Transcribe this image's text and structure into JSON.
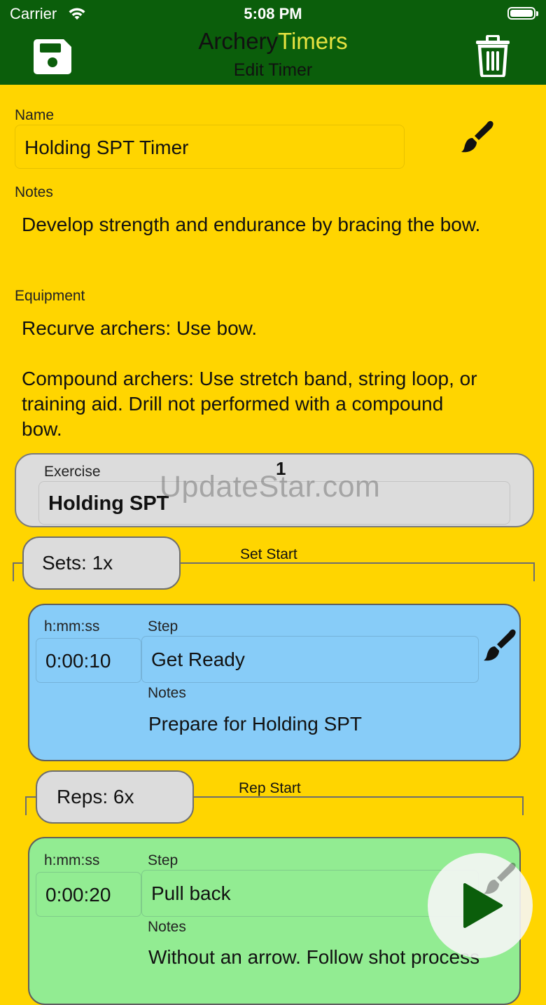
{
  "status": {
    "carrier": "Carrier",
    "time": "5:08 PM"
  },
  "nav": {
    "title_part1": "Archery",
    "title_part2": "Timers",
    "subtitle": "Edit Timer",
    "colors": {
      "background": "#0B5E0B",
      "accent": "#E7E340"
    },
    "left_icon": "save-icon",
    "right_icon": "trash-icon"
  },
  "form": {
    "name_label": "Name",
    "name_value": "Holding SPT Timer",
    "notes_label": "Notes",
    "notes_value": "Develop strength and endurance by bracing the bow.",
    "equipment_label": "Equipment",
    "equipment_line1": "Recurve archers: Use bow.",
    "equipment_line2": "Compound archers: Use stretch band, string loop, or",
    "equipment_line3": "training aid. Drill not performed with a compound",
    "equipment_line4": "bow."
  },
  "exercise": {
    "index": "1",
    "label": "Exercise",
    "value": "Holding SPT",
    "watermark": "UpdateStar.com"
  },
  "sets": {
    "label": "Sets: 1x",
    "marker": "Set Start"
  },
  "step1": {
    "time_label": "h:mm:ss",
    "time": "0:00:10",
    "step_label": "Step",
    "step": "Get Ready",
    "notes_label": "Notes",
    "notes": "Prepare for Holding SPT",
    "color": "#87CCF8"
  },
  "reps": {
    "label": "Reps: 6x",
    "marker": "Rep Start"
  },
  "step2": {
    "time_label": "h:mm:ss",
    "time": "0:00:20",
    "step_label": "Step",
    "step": "Pull back",
    "notes_label": "Notes",
    "notes": "Without an arrow. Follow shot process",
    "color": "#92EC92"
  },
  "fab": {
    "icon": "play-icon"
  },
  "page_background": "#FFD500"
}
